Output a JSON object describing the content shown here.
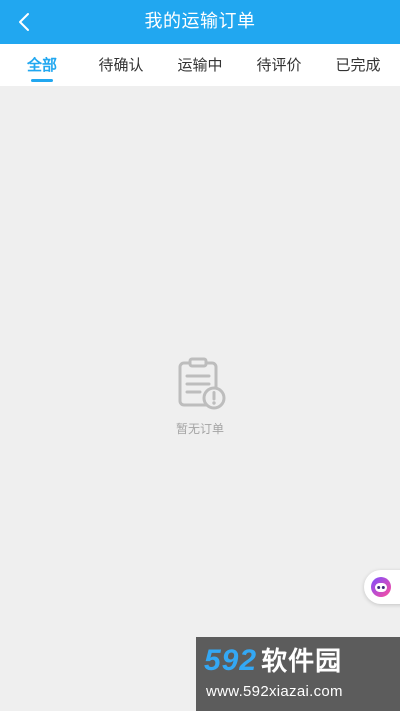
{
  "header": {
    "title": "我的运输订单",
    "back_icon": "chevron-left-icon"
  },
  "tabs": [
    {
      "label": "全部",
      "active": true
    },
    {
      "label": "待确认",
      "active": false
    },
    {
      "label": "运输中",
      "active": false
    },
    {
      "label": "待评价",
      "active": false
    },
    {
      "label": "已完成",
      "active": false
    }
  ],
  "empty_state": {
    "icon": "clipboard-alert-icon",
    "text": "暂无订单"
  },
  "floating_assistant": {
    "icon": "robot-face-icon"
  },
  "watermark": {
    "brand_number": "592",
    "brand_text": "软件园",
    "url": "www.592xiazai.com"
  },
  "colors": {
    "primary": "#21a7f0",
    "background": "#efefef",
    "tab_text": "#333333",
    "empty_text": "#a4a4a4"
  }
}
